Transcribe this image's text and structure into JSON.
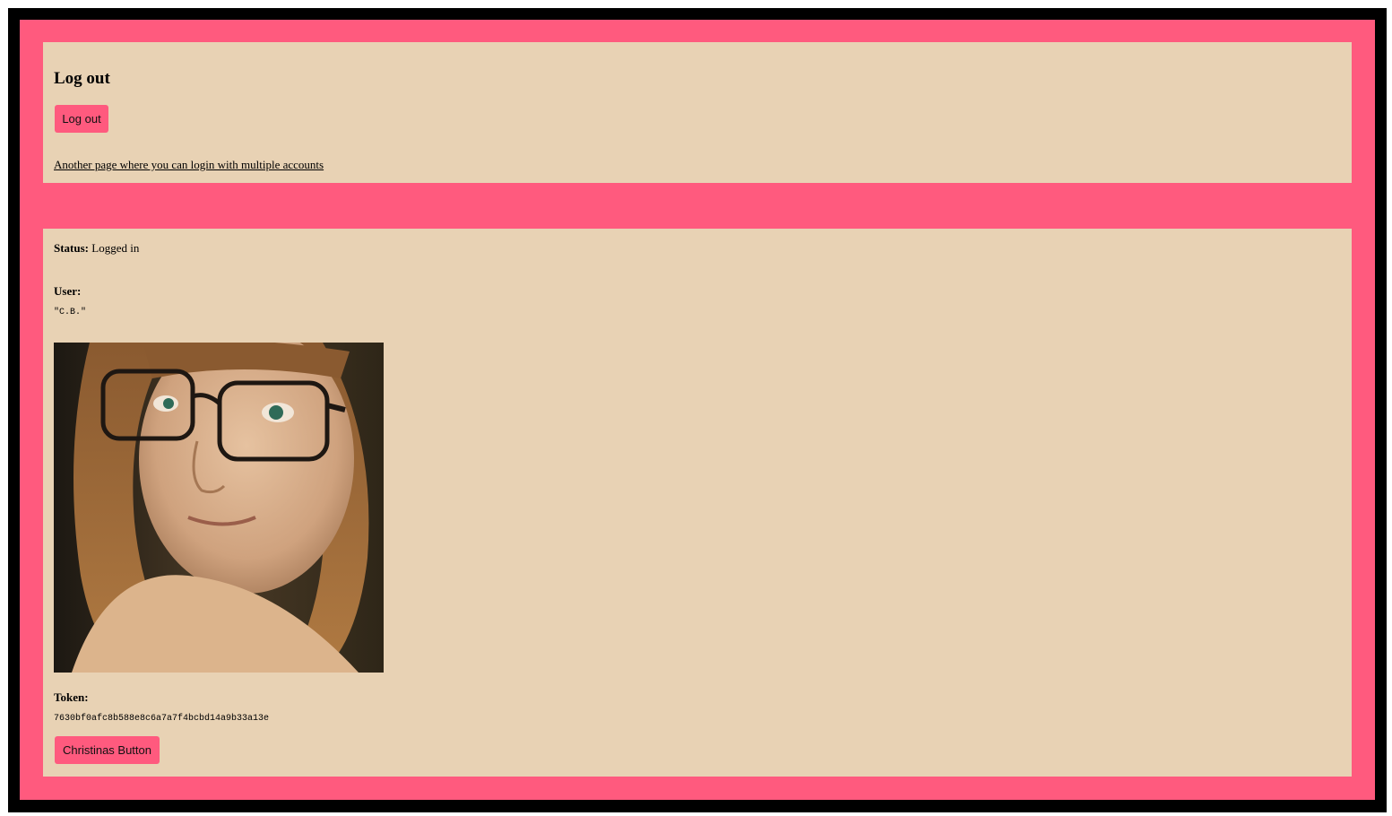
{
  "logout_section": {
    "heading": "Log out",
    "button_label": "Log out",
    "link_text": "Another page where you can login with multiple accounts"
  },
  "status_section": {
    "status_label": "Status:",
    "status_value": "Logged in",
    "user_label": "User:",
    "user_value": "\"C.B.\"",
    "token_label": "Token:",
    "token_value": "7630bf0afc8b588e8c6a7a7f4bcbd14a9b33a13e",
    "button_label": "Christinas Button"
  },
  "colors": {
    "outer_border": "#000000",
    "accent": "#ff5a7e",
    "panel_bg": "#e8d2b4"
  }
}
